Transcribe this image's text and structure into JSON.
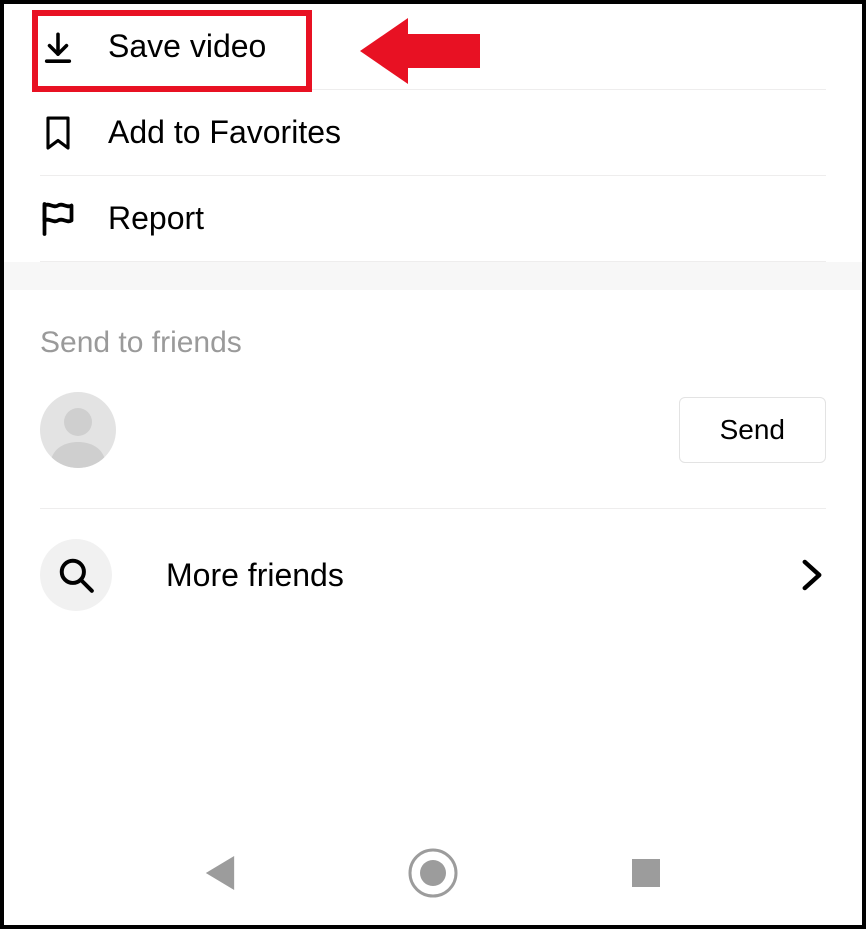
{
  "menu": {
    "save_video": "Save video",
    "add_favorites": "Add to Favorites",
    "report": "Report"
  },
  "section": {
    "send_to_friends": "Send to friends"
  },
  "buttons": {
    "send": "Send"
  },
  "more_friends": "More friends",
  "highlight": {
    "target": "save-video",
    "color": "#e81123"
  }
}
